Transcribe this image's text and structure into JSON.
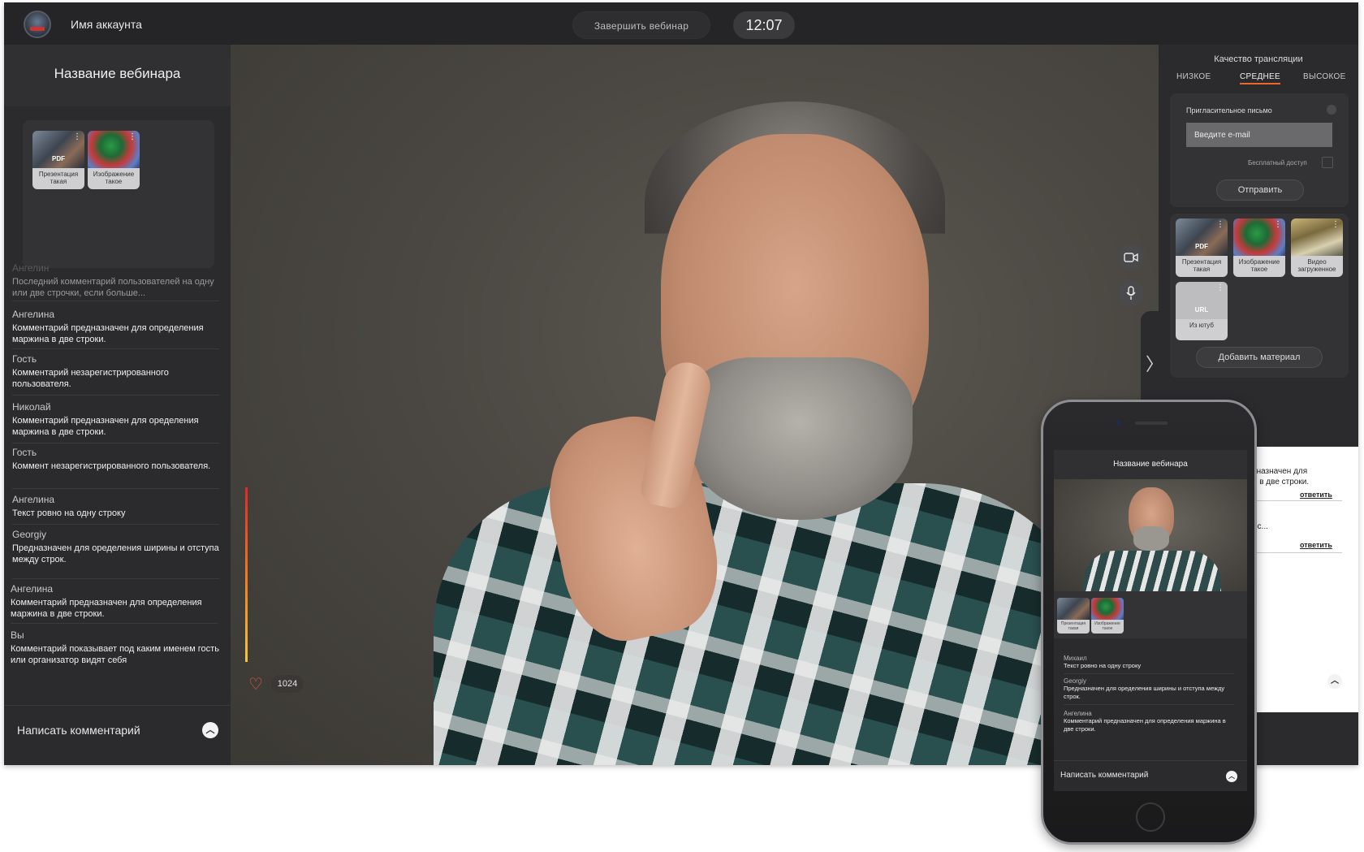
{
  "header": {
    "account_name": "Имя аккаунта",
    "end_webinar_label": "Завершить вебинар",
    "timer": "12:07",
    "logo_icon": "webinar-logo-icon"
  },
  "left_panel": {
    "webinar_title": "Название вебинара",
    "materials": [
      {
        "badge": "PDF",
        "caption": "Презентация такая",
        "icon": "pdf-icon"
      },
      {
        "badge": "",
        "caption": "Изображение такое",
        "icon": "eye-icon"
      }
    ],
    "comments": [
      {
        "author": "Ангелин",
        "text": "Последний комментарий пользователей на одну или две строчки, если больше..."
      },
      {
        "author": "Ангелина",
        "text": "Комментарий предназначен для определения маржина в две строки."
      },
      {
        "author": "Гость",
        "text": "Комментарий незарегистрированного пользователя."
      },
      {
        "author": "Николай",
        "text": "Комментарий предназначен для оределения маржина в две строки."
      },
      {
        "author": "Гость",
        "text": "Коммент незарегистрированного пользователя."
      },
      {
        "author": "Ангелина",
        "text": "Текст ровно на одну строку"
      },
      {
        "author": "Georgiy",
        "text": "Предназначен для оределения ширины и отступа между строк."
      },
      {
        "author": "Ангелина",
        "text": "Комментарий предназначен для определения маржина в две строки."
      },
      {
        "author": "Вы",
        "text": "Комментарий показывает под каким именем гость или организатор видят себя"
      }
    ],
    "write_comment_label": "Написать комментарий"
  },
  "video": {
    "camera_icon": "camera-icon",
    "mic_icon": "microphone-icon",
    "likes_count": "1024",
    "heart_icon": "heart-icon",
    "collapse_icon": "chevron-right-icon"
  },
  "right_panel": {
    "quality_title": "Качество трансляции",
    "quality_options": [
      "НИЗКОЕ",
      "СРЕДНЕЕ",
      "ВЫСОКОЕ"
    ],
    "quality_selected": "СРЕДНЕЕ",
    "invite": {
      "title": "Пригласительное письмо",
      "email_placeholder": "Введите e-mail",
      "free_access_label": "Бесплатный доступ",
      "send_label": "Отправить"
    },
    "materials": [
      {
        "badge": "PDF",
        "caption": "Презентация такая",
        "icon": "pdf-icon"
      },
      {
        "badge": "",
        "caption": "Изображение такое",
        "icon": "eye-icon"
      },
      {
        "badge": "",
        "caption": "Видео загруженное",
        "icon": "film-icon"
      },
      {
        "badge": "URL",
        "caption": "Из ютуб",
        "icon": "link-icon"
      }
    ],
    "add_material_label": "Добавить материал",
    "chat_fragments": [
      {
        "text": "зназначен для\nя в две строки.",
        "reply": "ответить"
      },
      {
        "text": "ос...",
        "reply": "ответить"
      }
    ]
  },
  "phone": {
    "webinar_title": "Название вебинара",
    "materials": [
      {
        "caption": "Презентация такая"
      },
      {
        "caption": "Изображение такое"
      }
    ],
    "comments": [
      {
        "author": "Михаил",
        "text": "Текст ровно на одну строку"
      },
      {
        "author": "Georgiy",
        "text": "Предназначен для оределения ширины и отступа между строк."
      },
      {
        "author": "Ангелина",
        "text": "Комментарий предназначен для определения маржина в две строки."
      }
    ],
    "write_comment_label": "Написать комментарий"
  },
  "colors": {
    "background": "#2b2b2d",
    "accent": "#e8692a",
    "heart": "#f05a4a"
  }
}
